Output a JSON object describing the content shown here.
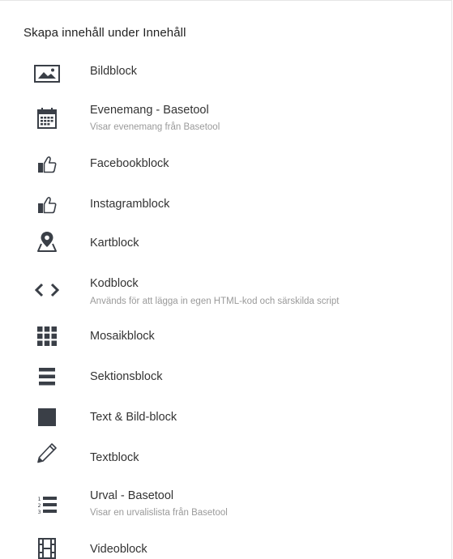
{
  "panel": {
    "title": "Skapa innehåll under Innehåll"
  },
  "items": [
    {
      "icon": "image-icon",
      "label": "Bildblock"
    },
    {
      "icon": "calendar-icon",
      "label": "Evenemang - Basetool",
      "description": "Visar evenemang från Basetool"
    },
    {
      "icon": "thumbs-up-icon",
      "label": "Facebookblock"
    },
    {
      "icon": "thumbs-up-icon",
      "label": "Instagramblock"
    },
    {
      "icon": "map-marker-icon",
      "label": "Kartblock"
    },
    {
      "icon": "code-icon",
      "label": "Kodblock",
      "description": "Används för att lägga in egen HTML-kod och särskilda script"
    },
    {
      "icon": "grid-icon",
      "label": "Mosaikblock"
    },
    {
      "icon": "bars-icon",
      "label": "Sektionsblock"
    },
    {
      "icon": "square-icon",
      "label": "Text & Bild-block"
    },
    {
      "icon": "pencil-icon",
      "label": "Textblock"
    },
    {
      "icon": "ordered-list-icon",
      "label": "Urval - Basetool",
      "description": "Visar en urvalislista från Basetool"
    },
    {
      "icon": "film-icon",
      "label": "Videoblock"
    }
  ],
  "colors": {
    "icon": "#3a3f47",
    "text": "#333333",
    "description": "#9a9a9a",
    "border": "#e6e6e6"
  }
}
